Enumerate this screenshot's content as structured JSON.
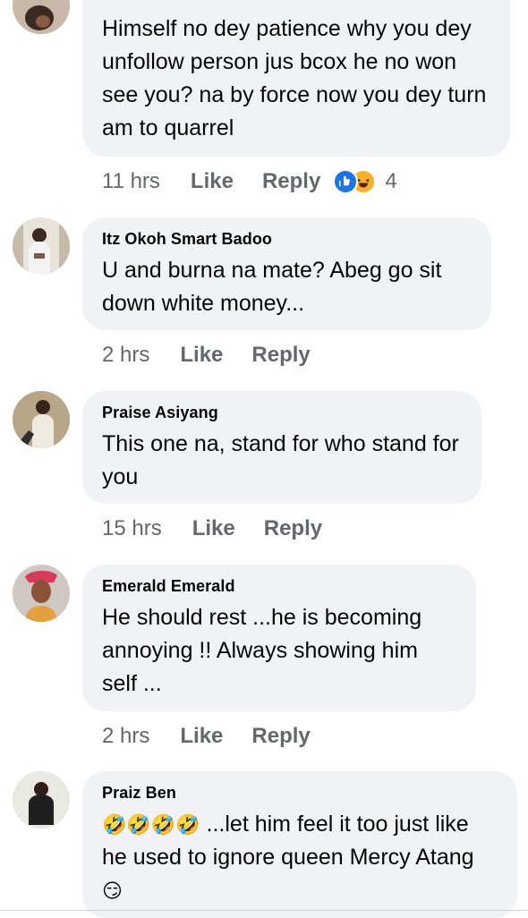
{
  "comments": [
    {
      "name": "",
      "text": "Himself no dey patience why you dey unfollow person jus bcox he no won see you? na by force now you dey turn am to quarrel",
      "time": "11 hrs",
      "like": "Like",
      "reply": "Reply",
      "reaction_count": "4",
      "reactions": [
        "like-icon",
        "laughing-face-icon"
      ]
    },
    {
      "name": "Itz Okoh Smart Badoo",
      "text": "U and burna na mate? Abeg go sit down white money...",
      "time": "2 hrs",
      "like": "Like",
      "reply": "Reply"
    },
    {
      "name": "Praise Asiyang",
      "text": "This one na, stand for who stand for you",
      "time": "15 hrs",
      "like": "Like",
      "reply": "Reply"
    },
    {
      "name": "Emerald Emerald",
      "text": "He should rest ...he is becoming annoying !! Always showing him self ...",
      "time": "2 hrs",
      "like": "Like",
      "reply": "Reply"
    },
    {
      "name": "Praiz Ben",
      "emoji_prefix": "🤣🤣🤣🤣",
      "text": " ...let him feel it too just like he used to ignore queen  Mercy Atang ",
      "emoji_suffix": "😏",
      "time": "",
      "like": "",
      "reply": ""
    }
  ],
  "colors": {
    "bubble": "#f0f2f5",
    "meta_text": "#65676b",
    "like_blue": "#1b74e4",
    "laugh_yellow": "#f7b125"
  }
}
